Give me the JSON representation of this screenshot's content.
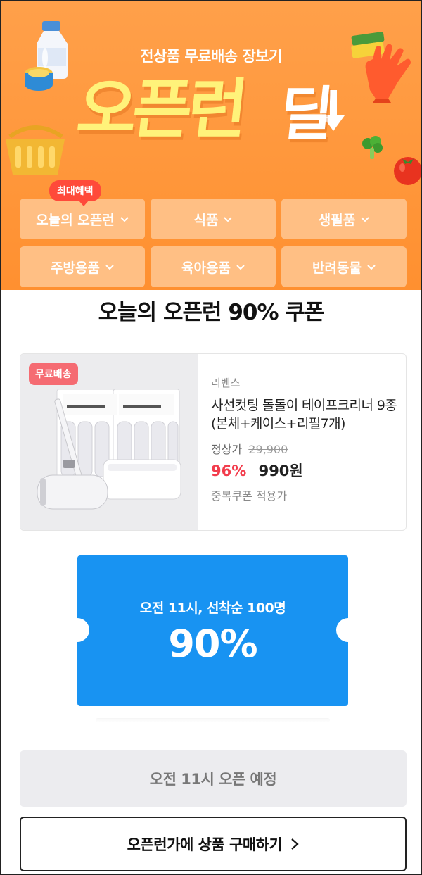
{
  "hero": {
    "subtitle": "전상품 무료배송 장보기",
    "title": "오픈런",
    "title_suffix": "딜",
    "colors": {
      "background": "#ff9b3f",
      "title": "#fff27a"
    }
  },
  "categories": {
    "badge": "최대혜택",
    "items": [
      {
        "label": "오늘의 오픈런",
        "icon": "chevron-down-icon"
      },
      {
        "label": "식품",
        "icon": "chevron-down-icon"
      },
      {
        "label": "생필품",
        "icon": "chevron-down-icon"
      },
      {
        "label": "주방용품",
        "icon": "chevron-down-icon"
      },
      {
        "label": "육아용품",
        "icon": "chevron-down-icon"
      },
      {
        "label": "반려동물",
        "icon": "chevron-down-icon"
      }
    ]
  },
  "section": {
    "title": "오늘의 오픈런 90% 쿠폰"
  },
  "product": {
    "badge": "무료배송",
    "brand": "리벤스",
    "name": "사선컷팅 돌돌이 테이프크리너 9종(본체+케이스+리필7개)",
    "regular_label": "정상가",
    "regular_price": "29,900",
    "discount": "96%",
    "price": "990원",
    "note": "중복쿠폰 적용가",
    "colors": {
      "discount": "#f23c4c"
    }
  },
  "coupon": {
    "subtitle": "오전 11시, 선착순 100명",
    "value": "90%",
    "colors": {
      "background": "#1893f2"
    }
  },
  "actions": {
    "open_label": "오전 11시 오픈 예정",
    "buy_label": "오픈런가에 상품 구매하기",
    "buy_icon": "chevron-right-icon"
  }
}
